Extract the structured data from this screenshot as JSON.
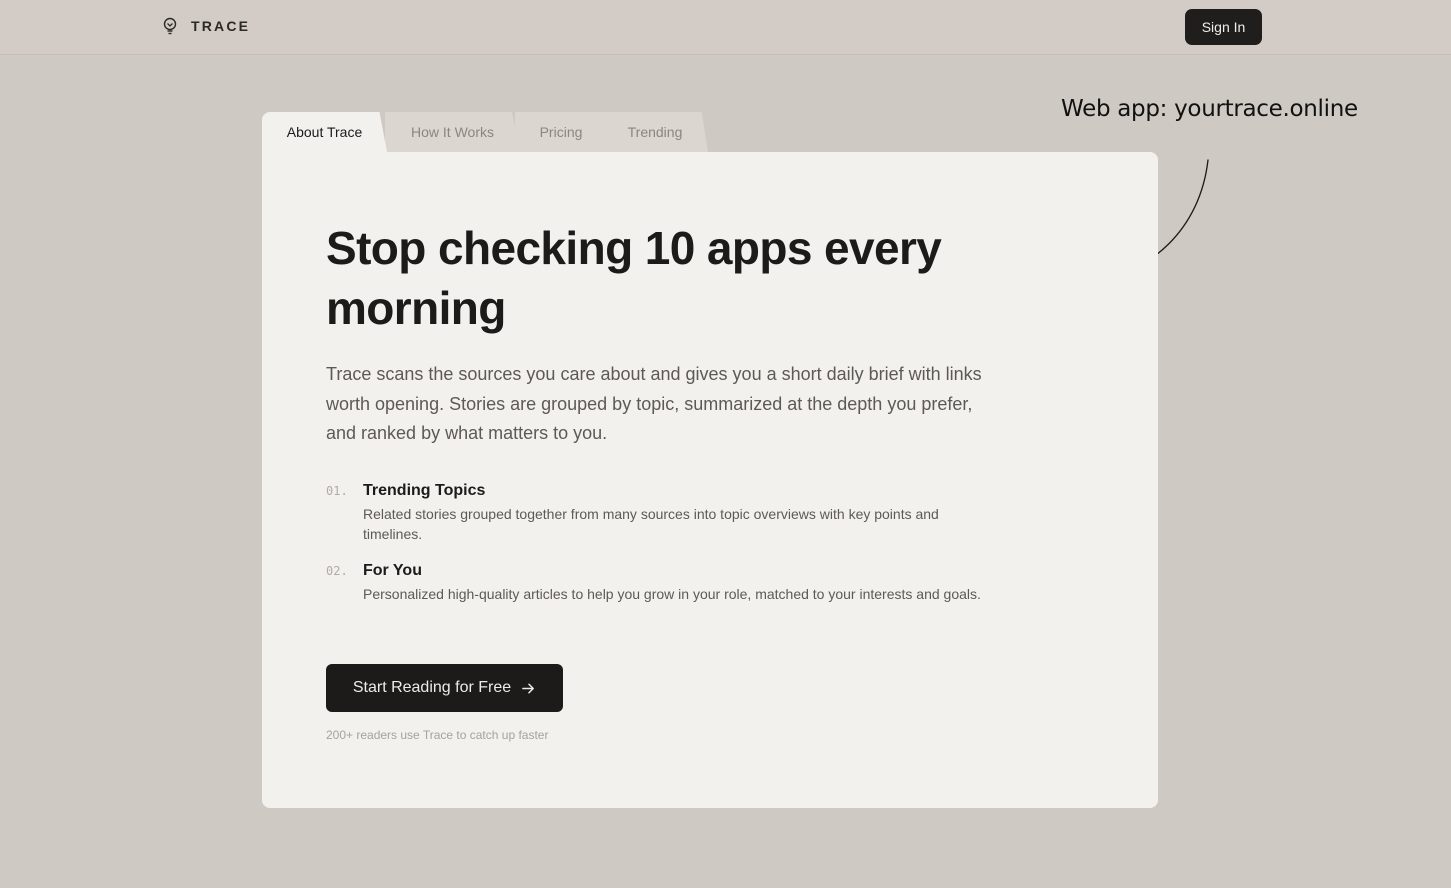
{
  "header": {
    "brand": "TRACE",
    "logo_icon": "bulb-icon",
    "sign_in_label": "Sign In"
  },
  "annotation": {
    "text": "Web app: yourtrace.online",
    "arrow_icon": "hand-drawn-arrow-icon"
  },
  "tabs": [
    {
      "label": "About Trace",
      "active": true
    },
    {
      "label": "How It Works",
      "active": false
    },
    {
      "label": "Pricing",
      "active": false
    },
    {
      "label": "Trending",
      "active": false
    }
  ],
  "hero": {
    "headline": "Stop checking 10 apps every morning",
    "intro": "Trace scans the sources you care about and gives you a short daily brief with links worth opening. Stories are grouped by topic, summarized at the depth you prefer, and ranked by what matters to you."
  },
  "features": [
    {
      "number": "01.",
      "title": "Trending Topics",
      "description": "Related stories grouped together from many sources into topic overviews with key points and timelines."
    },
    {
      "number": "02.",
      "title": "For You",
      "description": "Personalized high-quality articles to help you grow in your role, matched to your interests and goals."
    }
  ],
  "cta": {
    "label": "Start Reading for Free",
    "icon": "arrow-right-icon"
  },
  "social_proof": "200+ readers use Trace to catch up faster",
  "colors": {
    "page_background": "#cec9c2",
    "card_background": "#f2f1ee",
    "primary_button": "#1c1b1a"
  }
}
